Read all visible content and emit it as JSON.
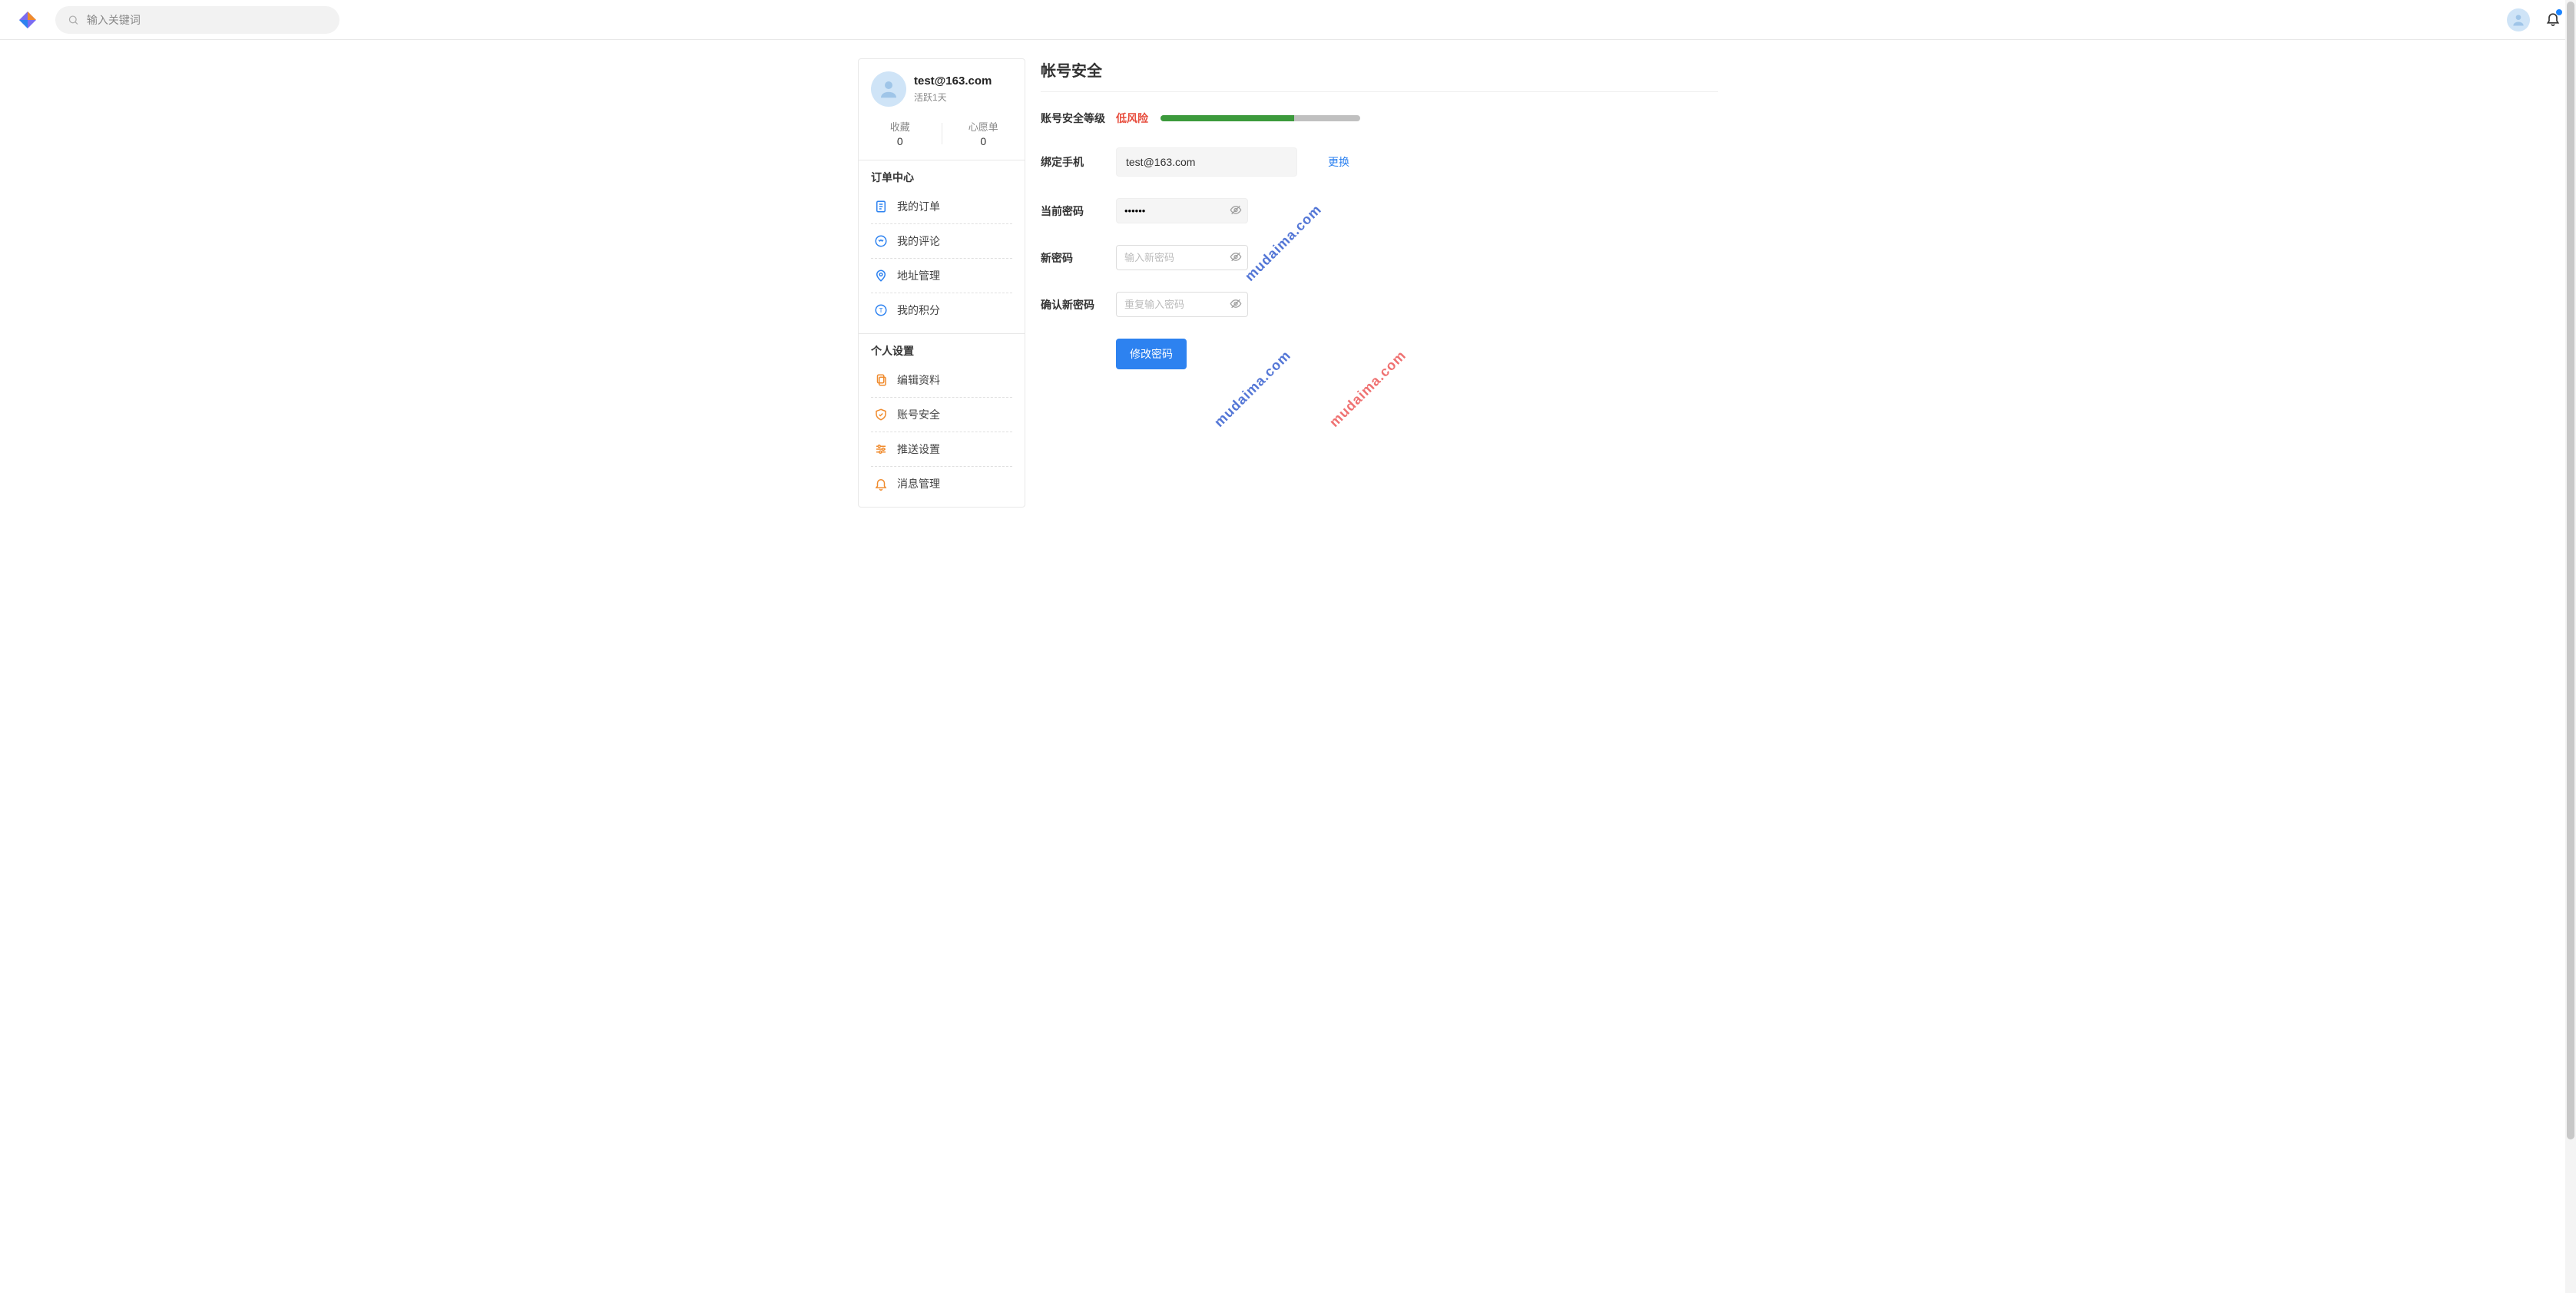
{
  "header": {
    "search_placeholder": "输入关键词"
  },
  "profile": {
    "name": "test@163.com",
    "activity": "活跃1天",
    "stats": {
      "fav_label": "收藏",
      "fav_value": "0",
      "wish_label": "心愿单",
      "wish_value": "0"
    }
  },
  "sidebar": {
    "section1_title": "订单中心",
    "items1": [
      {
        "label": "我的订单"
      },
      {
        "label": "我的评论"
      },
      {
        "label": "地址管理"
      },
      {
        "label": "我的积分"
      }
    ],
    "section2_title": "个人设置",
    "items2": [
      {
        "label": "编辑资料"
      },
      {
        "label": "账号安全"
      },
      {
        "label": "推送设置"
      },
      {
        "label": "消息管理"
      }
    ]
  },
  "main": {
    "title": "帐号安全",
    "security_level_label": "账号安全等级",
    "security_level_value": "低风险",
    "bind_phone_label": "绑定手机",
    "bind_phone_value": "test@163.com",
    "change_link": "更换",
    "current_pwd_label": "当前密码",
    "current_pwd_value": "••••••",
    "new_pwd_label": "新密码",
    "new_pwd_placeholder": "输入新密码",
    "confirm_pwd_label": "确认新密码",
    "confirm_pwd_placeholder": "重复输入密码",
    "submit_label": "修改密码"
  },
  "watermark": "mudaima.com"
}
